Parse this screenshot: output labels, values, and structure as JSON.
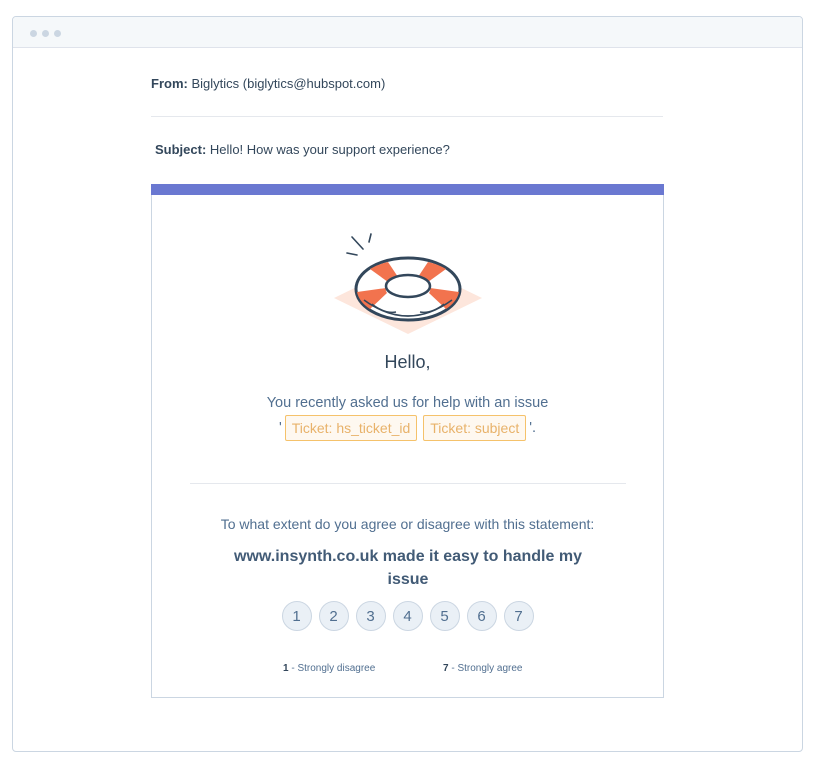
{
  "email": {
    "from_label": "From:",
    "from_value": "Biglytics (biglytics@hubspot.com)",
    "subject_label": "Subject:",
    "subject_value": "Hello! How was your support experience?"
  },
  "body": {
    "greeting": "Hello,",
    "message_line": "You recently asked us for help with an issue",
    "quote_open": "'",
    "ticket_id_token": "Ticket: hs_ticket_id",
    "ticket_subject_token": "Ticket: subject",
    "quote_close": "'.",
    "question": "To what extent do you agree or disagree with this statement:",
    "statement": "www.insynth.co.uk made it easy to handle my issue",
    "scale": [
      "1",
      "2",
      "3",
      "4",
      "5",
      "6",
      "7"
    ],
    "low_num": "1",
    "low_label": " - Strongly disagree",
    "high_num": "7",
    "high_label": " - Strongly agree"
  },
  "icons": {
    "illustration": "life-ring-icon"
  },
  "colors": {
    "accent_bar": "#6a78d1",
    "token_border": "#f5c26b",
    "life_ring": "#f2734e"
  }
}
